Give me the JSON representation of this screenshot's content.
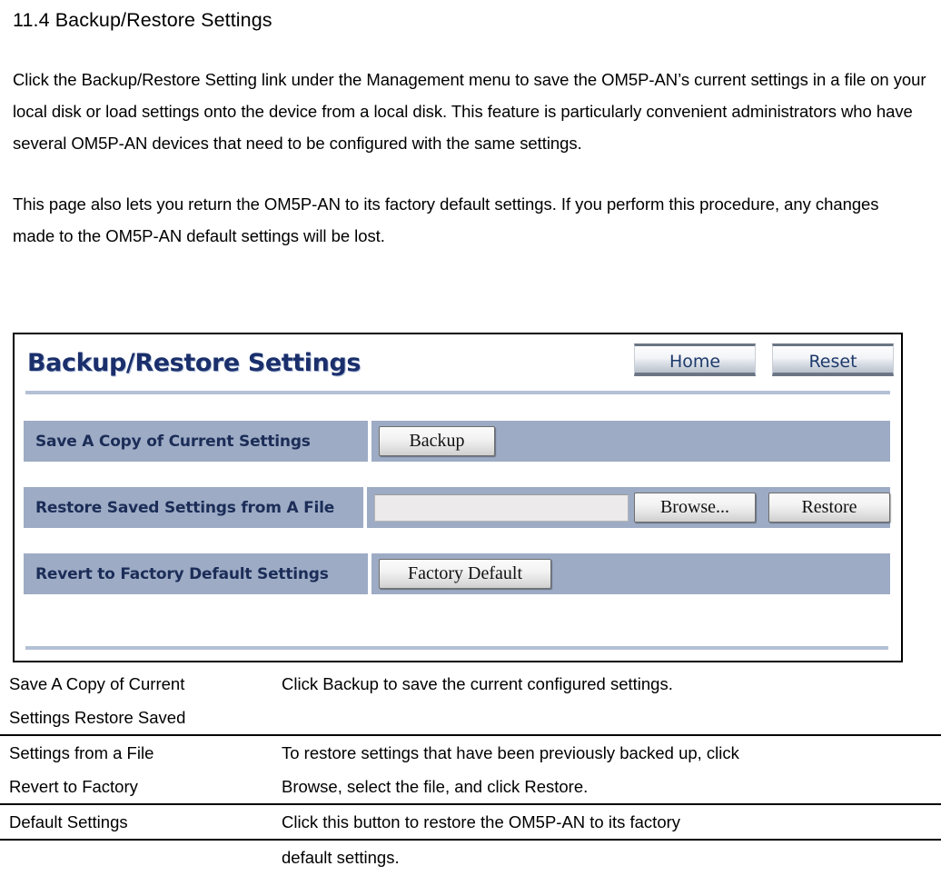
{
  "document": {
    "heading": "11.4 Backup/Restore Settings",
    "paragraph_1": "Click the Backup/Restore Setting link under the Management menu to save the OM5P-AN’s current settings in a file on your local disk or load settings onto the device from a local disk. This feature is particularly convenient administrators who have several OM5P-AN devices that need to be configured with the same settings.",
    "paragraph_2": "This page also lets you return the OM5P-AN to its factory default settings. If you perform this procedure, any changes made to the OM5P-AN default settings will be lost."
  },
  "screenshot": {
    "panel_title": "Backup/Restore Settings",
    "header_buttons": [
      {
        "label": "Home",
        "name": "home-button"
      },
      {
        "label": "Reset",
        "name": "reset-button"
      }
    ],
    "rows": [
      {
        "label": "Save A Copy of Current Settings",
        "button": "Backup"
      },
      {
        "label": "Restore Saved Settings from A File",
        "file_value": "",
        "file_placeholder": "",
        "browse_button": "Browse...",
        "restore_button": "Restore"
      },
      {
        "label": "Revert to Factory Default Settings",
        "button": "Factory Default"
      }
    ],
    "colors": {
      "row_background": "#9dabc5",
      "title_color": "#1a2f6b",
      "rule_color": "#b3c0d6"
    }
  },
  "description_table": {
    "rows": [
      {
        "term_line_1": "Save A Copy of Current",
        "term_line_2": "Settings Restore Saved",
        "description": "Click Backup to save the current configured settings."
      },
      {
        "term_line_1": "Settings from a File",
        "term_line_2": "Revert to Factory",
        "description_line_1": "To restore settings that have been previously backed up, click",
        "description_line_2": "Browse, select the file, and click Restore."
      },
      {
        "term_line_1": "Default Settings",
        "description_line_1": "Click this button  to restore the OM5P-AN to its factory",
        "description_line_2": "default settings."
      }
    ]
  }
}
